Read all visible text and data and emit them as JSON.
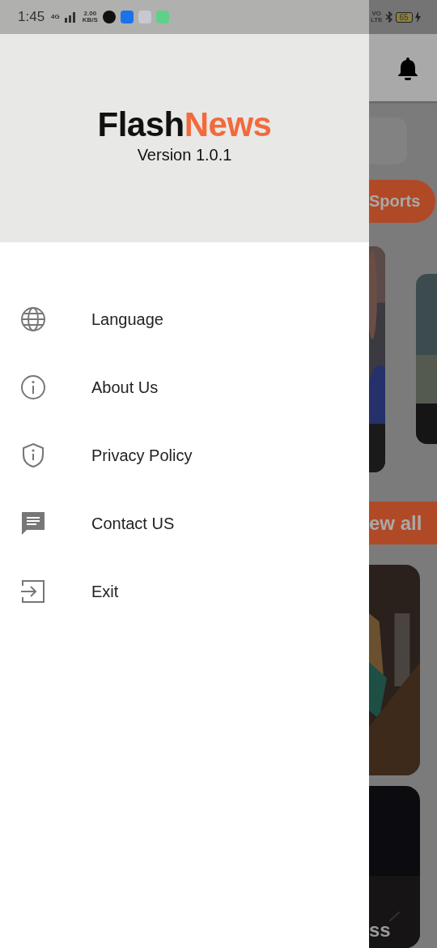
{
  "status_bar": {
    "time": "1:45",
    "network": "4G",
    "speed": "2.00",
    "speed_unit": "KB/S",
    "volte_top": "VO",
    "volte_bottom": "LTE",
    "battery": "65"
  },
  "drawer": {
    "brand": [
      {
        "text": "Flash",
        "kind": "plain"
      },
      {
        "text": "News",
        "kind": "accent"
      }
    ],
    "version": "Version 1.0.1",
    "items": [
      {
        "label": "Language",
        "kind": "globe"
      },
      {
        "label": "About Us",
        "kind": "info"
      },
      {
        "label": "Privacy Policy",
        "kind": "shield"
      },
      {
        "label": "Contact US",
        "kind": "message"
      },
      {
        "label": "Exit",
        "kind": "exit"
      }
    ]
  },
  "background_page": {
    "category_chip": "Sports",
    "view_all_button": "ew all",
    "card_caption": "ss"
  }
}
